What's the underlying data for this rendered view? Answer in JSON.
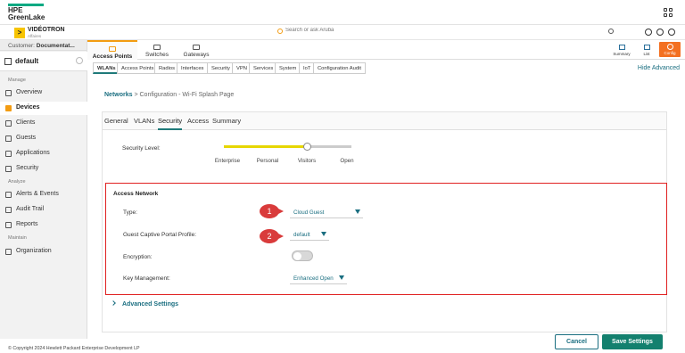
{
  "header": {
    "logo_line1": "HPE",
    "logo_line2": "GreenLake",
    "brand_name": "VIDÉOTRON",
    "brand_sub": "Affaires",
    "brand_badge": ">",
    "search_placeholder": "Search or ask Aruba"
  },
  "sidebar": {
    "customer_label": "Customer:",
    "customer_value": "Documentat...",
    "group": "default",
    "sections": {
      "manage": "Manage",
      "analyze": "Analyze",
      "maintain": "Maintain"
    },
    "items": [
      {
        "label": "Overview"
      },
      {
        "label": "Devices"
      },
      {
        "label": "Clients"
      },
      {
        "label": "Guests"
      },
      {
        "label": "Applications"
      },
      {
        "label": "Security"
      },
      {
        "label": "Alerts & Events"
      },
      {
        "label": "Audit Trail"
      },
      {
        "label": "Reports"
      },
      {
        "label": "Organization"
      }
    ]
  },
  "device_tabs": [
    {
      "label": "Access Points"
    },
    {
      "label": "Switches"
    },
    {
      "label": "Gateways"
    }
  ],
  "right_tabs": [
    {
      "label": "Summary"
    },
    {
      "label": "List"
    },
    {
      "label": "Config"
    }
  ],
  "sub_tabs": [
    "WLANs",
    "Access Points",
    "Radios",
    "Interfaces",
    "Security",
    "VPN",
    "Services",
    "System",
    "IoT",
    "Configuration Audit"
  ],
  "hide_advanced": "Hide Advanced",
  "breadcrumb": {
    "link": "Networks",
    "rest": "> Configuration - Wi-Fi Splash Page"
  },
  "card_tabs": [
    "General",
    "VLANs",
    "Security",
    "Access",
    "Summary"
  ],
  "security_level": {
    "label": "Security Level:",
    "options": [
      "Enterprise",
      "Personal",
      "Visitors",
      "Open"
    ],
    "selected": "Visitors"
  },
  "access_network": {
    "title": "Access Network",
    "type_label": "Type:",
    "type_value": "Cloud Guest",
    "portal_label": "Guest Captive Portal Profile:",
    "portal_value": "default",
    "encryption_label": "Encryption:",
    "encryption_on": false,
    "key_label": "Key Management:",
    "key_value": "Enhanced Open",
    "callouts": [
      "1",
      "2"
    ]
  },
  "advanced_settings": "Advanced Settings",
  "footer": {
    "copyright": "© Copyright 2024 Hewlett Packard Enterprise Development LP",
    "cancel": "Cancel",
    "save": "Save Settings"
  },
  "colors": {
    "accent": "#f39c12",
    "teal": "#1a6e80",
    "save": "#13806e",
    "highlight": "#e02020"
  }
}
